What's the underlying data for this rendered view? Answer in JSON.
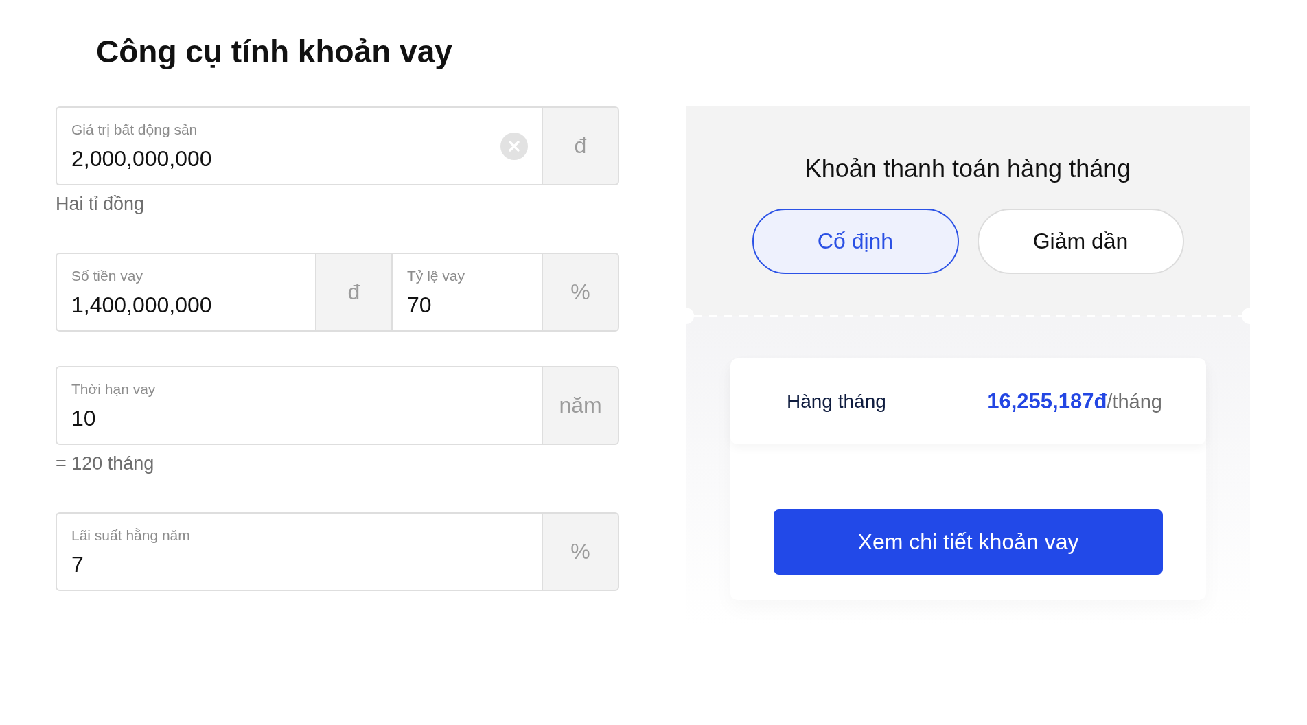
{
  "title": "Công cụ tính khoản vay",
  "form": {
    "groups": [
      {
        "fields": [
          {
            "label": "Giá trị bất động sản",
            "value": "2,000,000,000",
            "clearable": true,
            "unit": "đ"
          }
        ],
        "hint": "Hai tỉ đồng"
      },
      {
        "fields": [
          {
            "label": "Số tiền vay",
            "value": "1,400,000,000",
            "clearable": false,
            "unit": "đ"
          },
          {
            "label": "Tỷ lệ vay",
            "value": "70",
            "clearable": false,
            "unit": "%"
          }
        ]
      },
      {
        "fields": [
          {
            "label": "Thời hạn vay",
            "value": "10",
            "clearable": false,
            "unit": "năm"
          }
        ],
        "hint": "= 120 tháng"
      },
      {
        "fields": [
          {
            "label": "Lãi suất hằng năm",
            "value": "7",
            "clearable": false,
            "unit": "%"
          }
        ]
      }
    ]
  },
  "payment_panel": {
    "title": "Khoản thanh toán hàng tháng",
    "tabs": [
      {
        "label": "Cố định",
        "selected": true
      },
      {
        "label": "Giảm dần",
        "selected": false
      }
    ],
    "summary": {
      "label": "Hàng tháng",
      "amount": "16,255,187đ",
      "unit": "/tháng"
    },
    "button": "Xem chi tiết khoản vay"
  }
}
